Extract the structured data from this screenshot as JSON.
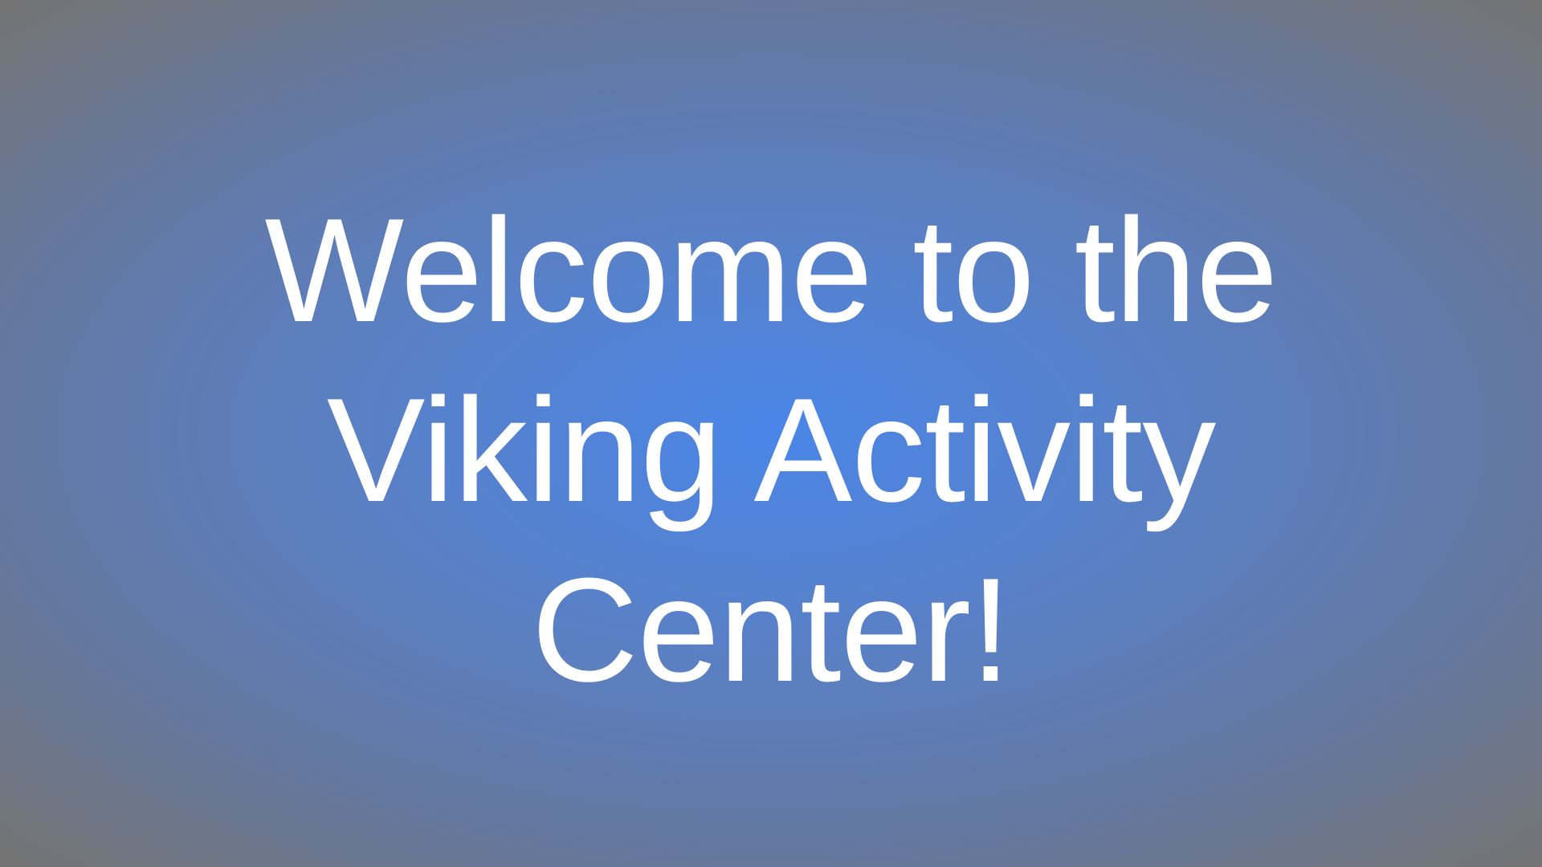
{
  "slide": {
    "lines": [
      "Welcome to the",
      "Viking Activity",
      "Center!"
    ]
  }
}
